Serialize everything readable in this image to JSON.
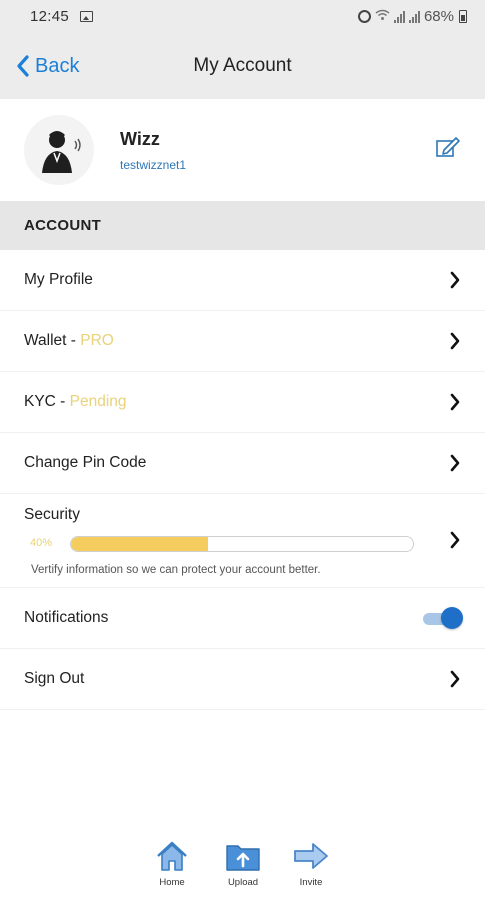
{
  "status_bar": {
    "time": "12:45",
    "battery": "68%",
    "icons": [
      "image-icon",
      "alarm-icon",
      "wifi-icon",
      "signal-icon",
      "signal-icon",
      "battery-icon"
    ]
  },
  "nav": {
    "back_label": "Back",
    "title": "My Account",
    "accent_color": "#1c7fd8"
  },
  "profile": {
    "name": "Wizz",
    "username": "testwizznet1",
    "avatar_icon": "person-avatar-icon",
    "edit_icon": "edit-icon"
  },
  "section": {
    "title": "ACCOUNT"
  },
  "menu": {
    "my_profile": "My Profile",
    "wallet_prefix": "Wallet - ",
    "wallet_status": "PRO",
    "kyc_prefix": "KYC - ",
    "kyc_status": "Pending",
    "change_pin": "Change Pin Code",
    "security": "Security",
    "security_percent_label": "40%",
    "security_progress": 0.4,
    "security_hint": "Vertify information so we can protect your account better.",
    "notifications": "Notifications",
    "notifications_on": true,
    "sign_out": "Sign Out",
    "status_color": "#e8d27a"
  },
  "tabs": [
    {
      "label": "Home",
      "icon": "home-icon"
    },
    {
      "label": "Upload",
      "icon": "upload-folder-icon"
    },
    {
      "label": "Invite",
      "icon": "arrow-right-icon"
    }
  ]
}
